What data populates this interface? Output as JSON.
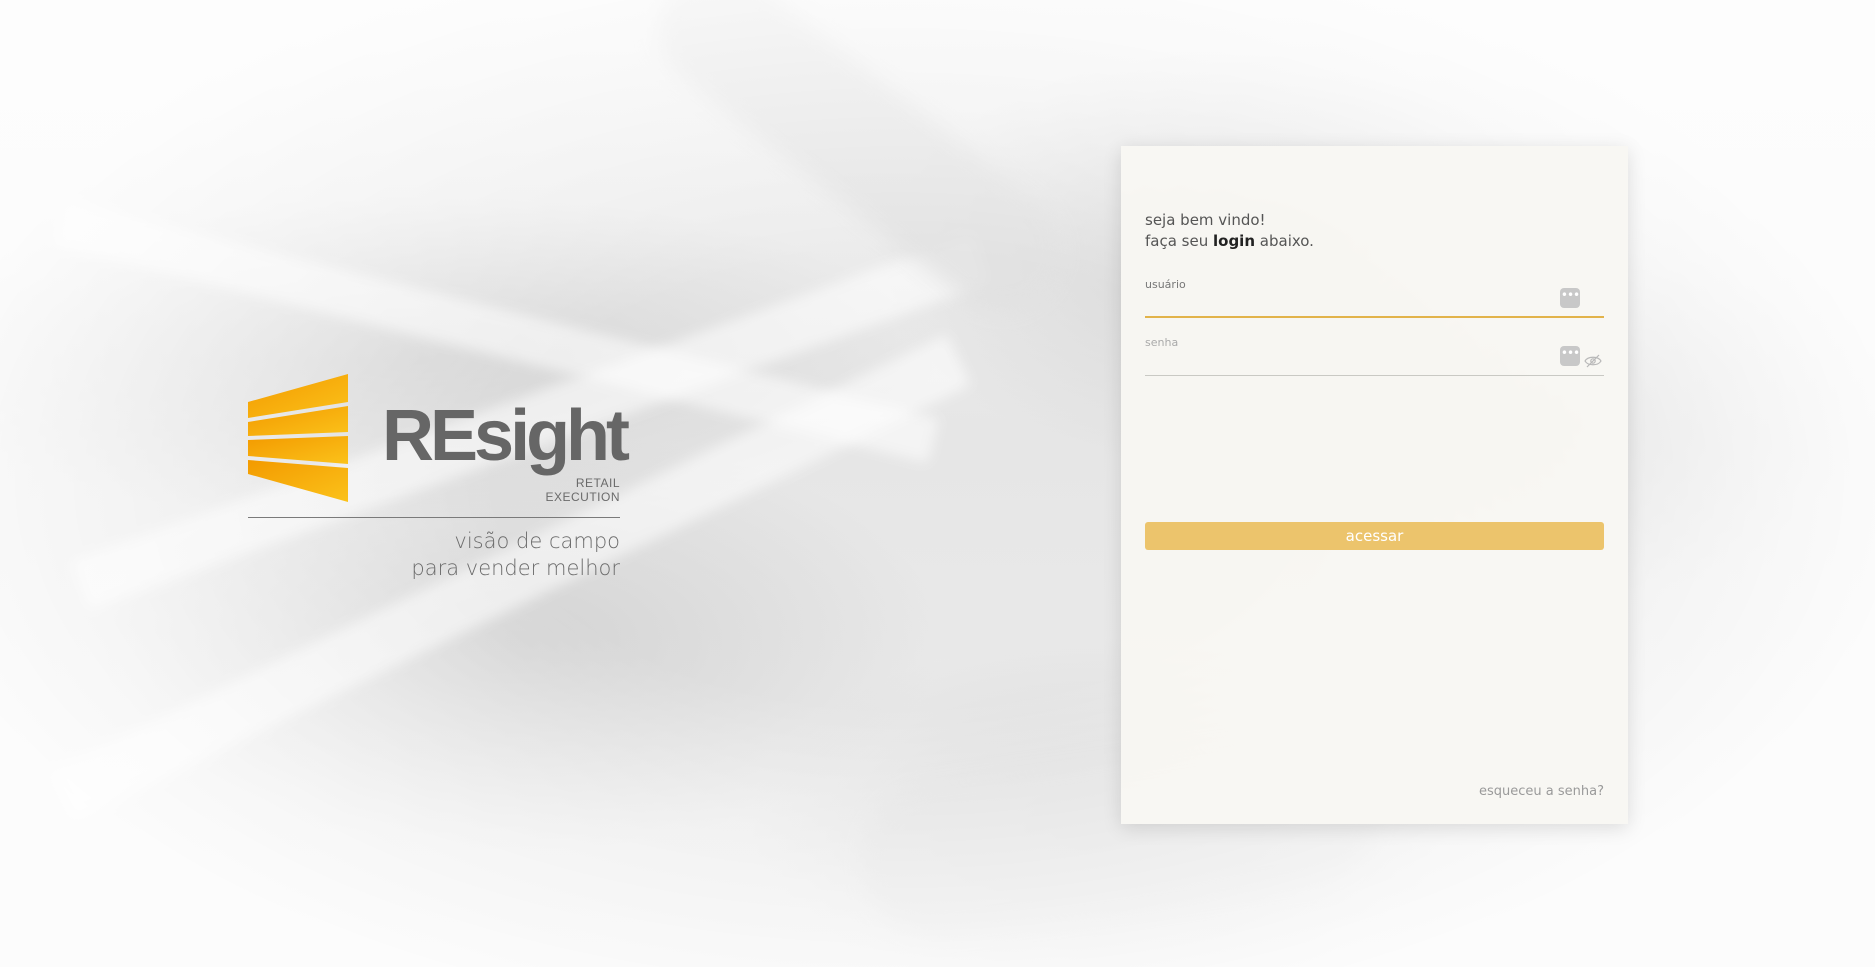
{
  "brand": {
    "logo_text": "REsight",
    "logo_sub_line1": "RETAIL",
    "logo_sub_line2": "EXECUTION",
    "tagline_line1": "visão de campo",
    "tagline_line2": "para vender melhor",
    "mark_colors": [
      "#f39a00",
      "#f7b200",
      "#fbc21a"
    ]
  },
  "login": {
    "welcome_line1": "seja bem vindo!",
    "welcome_line2_prefix": "faça seu ",
    "welcome_line2_bold": "login",
    "welcome_line2_suffix": " abaixo.",
    "username_label": "usuário",
    "username_value": "",
    "password_label": "senha",
    "password_value": "",
    "dots_icon_glyph": "•••",
    "submit_label": "acessar",
    "forgot_label": "esqueceu a senha?"
  },
  "colors": {
    "accent": "#ecc46c",
    "focus_underline": "#e2b34a",
    "card_bg": "#f8f7f2"
  }
}
